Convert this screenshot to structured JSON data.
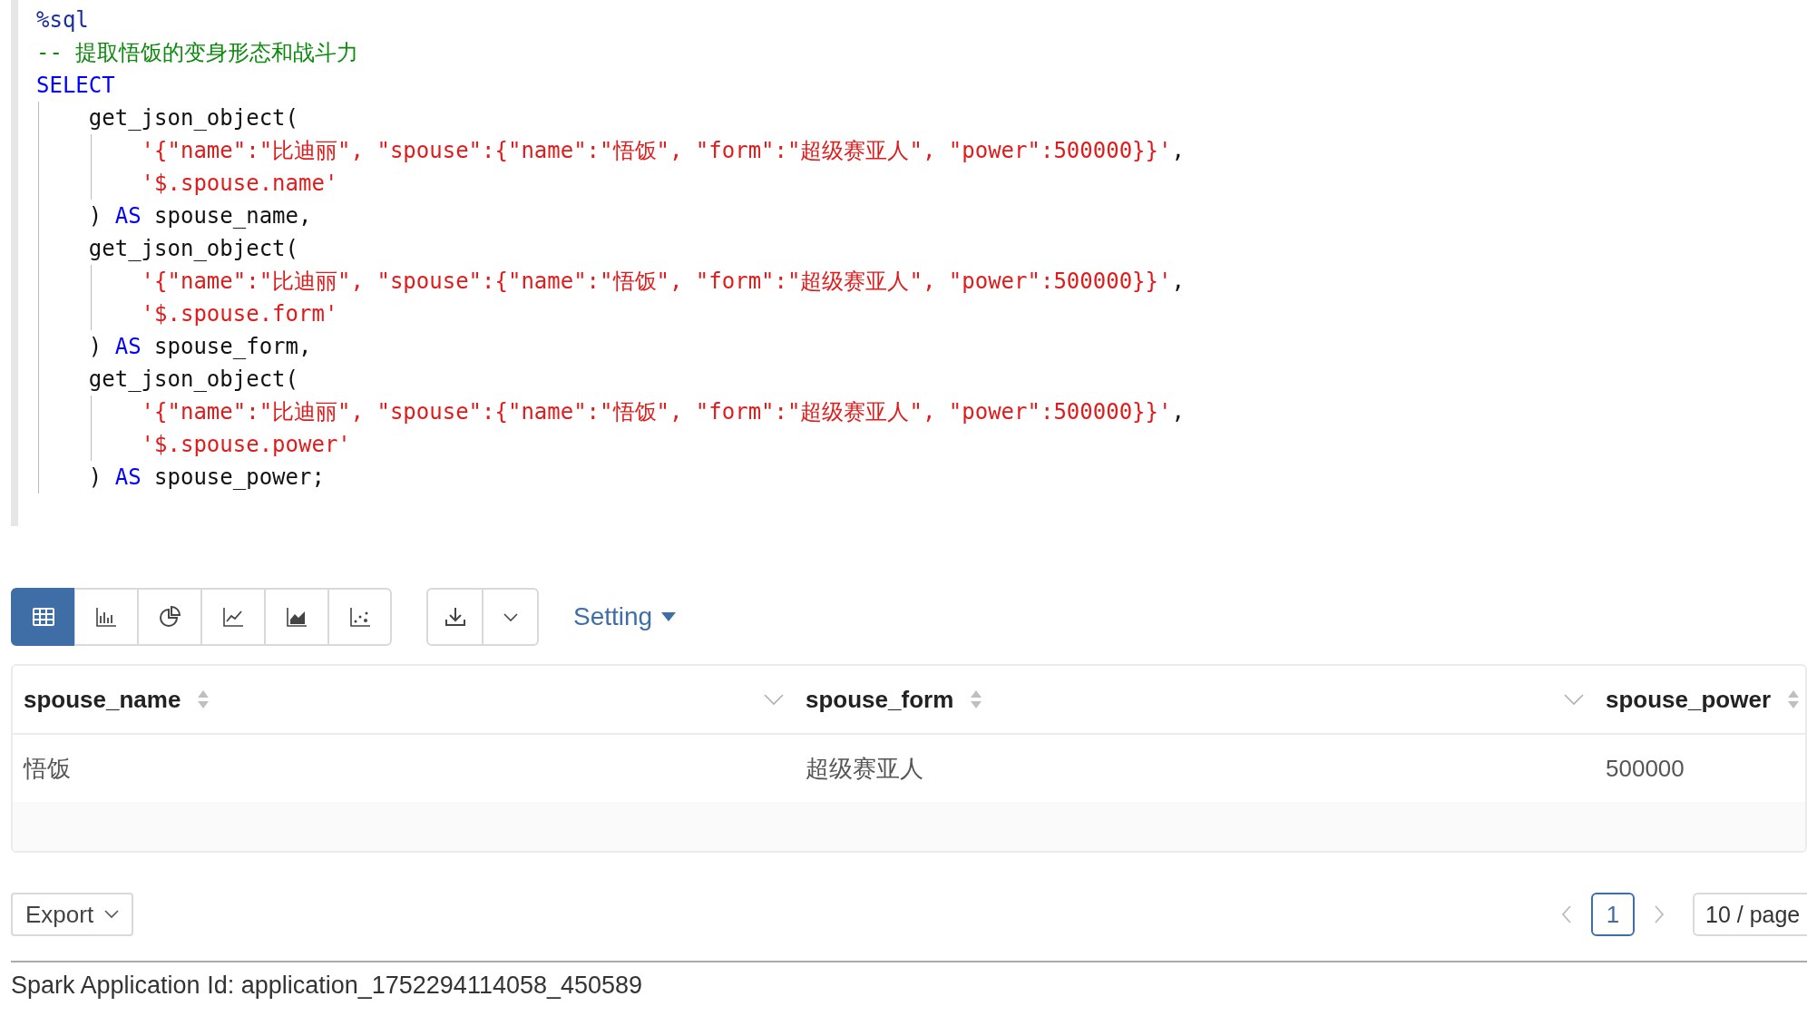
{
  "code_cell": {
    "lines": [
      {
        "tokens": [
          {
            "kind": "magic",
            "text": "%sql"
          }
        ]
      },
      {
        "tokens": [
          {
            "kind": "comment",
            "text": "-- 提取悟饭的变身形态和战斗力"
          }
        ]
      },
      {
        "tokens": [
          {
            "kind": "keyword",
            "text": "SELECT"
          }
        ]
      },
      {
        "tokens": [
          {
            "kind": "plain",
            "text": "    get_json_object("
          }
        ]
      },
      {
        "tokens": [
          {
            "kind": "string",
            "text": "        '{\"name\":\"比迪丽\", \"spouse\":{\"name\":\"悟饭\", \"form\":\"超级赛亚人\", \"power\":500000}}'"
          },
          {
            "kind": "plain",
            "text": ","
          }
        ]
      },
      {
        "tokens": [
          {
            "kind": "string",
            "text": "        '$.spouse.name'"
          }
        ]
      },
      {
        "tokens": [
          {
            "kind": "plain",
            "text": "    ) "
          },
          {
            "kind": "keyword",
            "text": "AS"
          },
          {
            "kind": "plain",
            "text": " spouse_name,"
          }
        ]
      },
      {
        "tokens": [
          {
            "kind": "plain",
            "text": "    get_json_object("
          }
        ]
      },
      {
        "tokens": [
          {
            "kind": "string",
            "text": "        '{\"name\":\"比迪丽\", \"spouse\":{\"name\":\"悟饭\", \"form\":\"超级赛亚人\", \"power\":500000}}'"
          },
          {
            "kind": "plain",
            "text": ","
          }
        ]
      },
      {
        "tokens": [
          {
            "kind": "string",
            "text": "        '$.spouse.form'"
          }
        ]
      },
      {
        "tokens": [
          {
            "kind": "plain",
            "text": "    ) "
          },
          {
            "kind": "keyword",
            "text": "AS"
          },
          {
            "kind": "plain",
            "text": " spouse_form,"
          }
        ]
      },
      {
        "tokens": [
          {
            "kind": "plain",
            "text": "    get_json_object("
          }
        ]
      },
      {
        "tokens": [
          {
            "kind": "string",
            "text": "        '{\"name\":\"比迪丽\", \"spouse\":{\"name\":\"悟饭\", \"form\":\"超级赛亚人\", \"power\":500000}}'"
          },
          {
            "kind": "plain",
            "text": ","
          }
        ]
      },
      {
        "tokens": [
          {
            "kind": "string",
            "text": "        '$.spouse.power'"
          }
        ]
      },
      {
        "tokens": [
          {
            "kind": "plain",
            "text": "    ) "
          },
          {
            "kind": "keyword",
            "text": "AS"
          },
          {
            "kind": "plain",
            "text": " spouse_power;"
          }
        ]
      }
    ]
  },
  "toolbar": {
    "view_buttons": [
      {
        "kind": "table",
        "selected": true
      },
      {
        "kind": "bar",
        "selected": false
      },
      {
        "kind": "pie",
        "selected": false
      },
      {
        "kind": "line",
        "selected": false
      },
      {
        "kind": "area",
        "selected": false
      },
      {
        "kind": "scatter",
        "selected": false
      }
    ],
    "download_buttons": [
      {
        "kind": "download"
      },
      {
        "kind": "dropdown"
      }
    ],
    "setting": {
      "label": "Setting"
    }
  },
  "table": {
    "columns": [
      {
        "label": "spouse_name"
      },
      {
        "label": "spouse_form"
      },
      {
        "label": "spouse_power"
      }
    ],
    "rows": [
      [
        "悟饭",
        "超级赛亚人",
        "500000"
      ]
    ]
  },
  "export": {
    "label": "Export"
  },
  "pagination": {
    "pages": [
      {
        "label": "1",
        "selected": true
      }
    ],
    "page_size": "10 / page"
  },
  "status": "Spark Application Id: application_1752294114058_450589"
}
